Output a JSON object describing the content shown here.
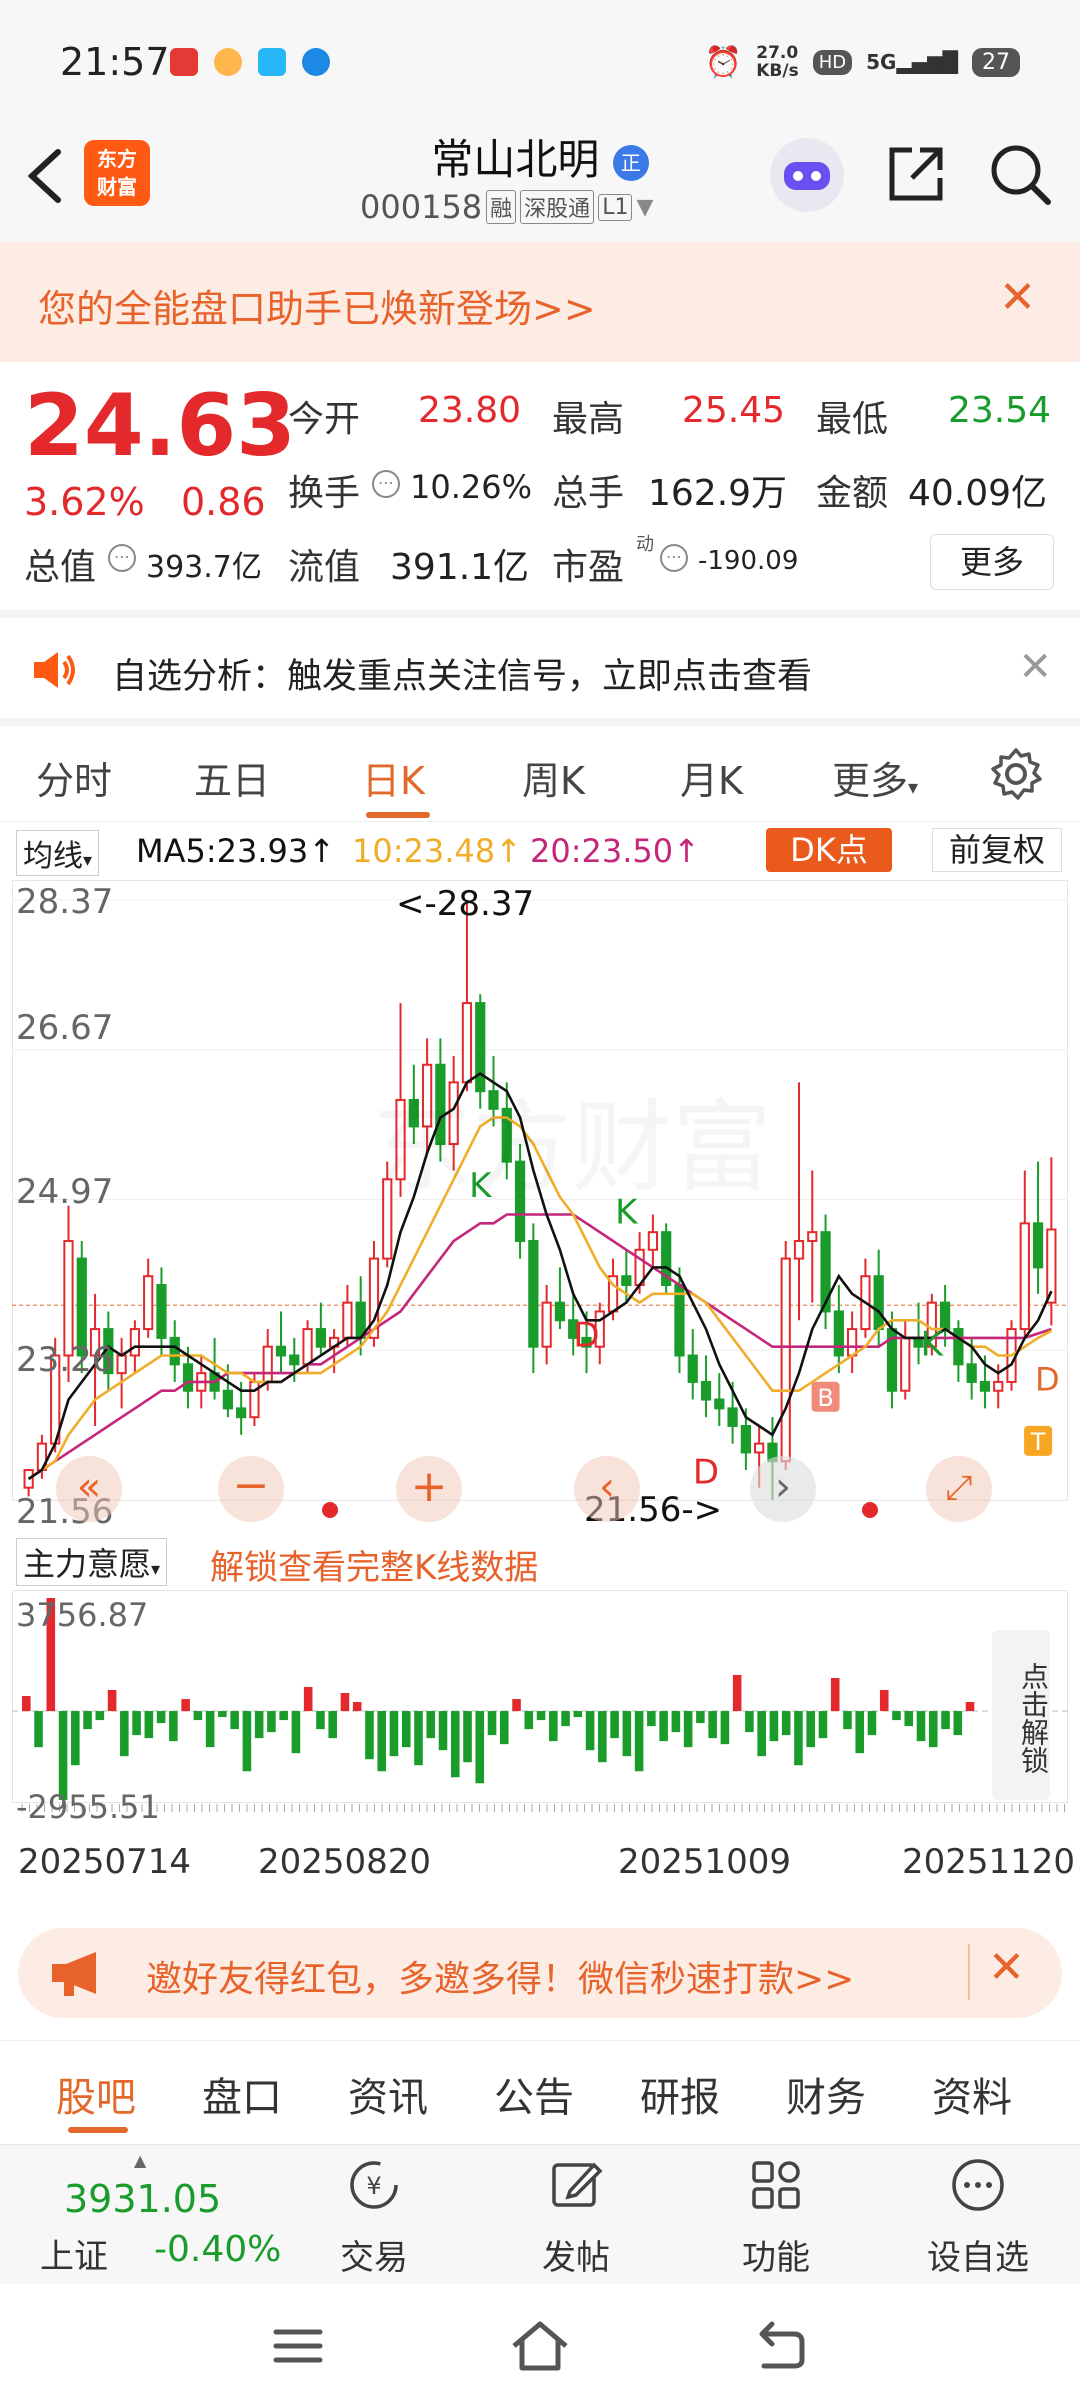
{
  "status_bar": {
    "time": "21:57",
    "net_speed_top": "27.0",
    "net_speed_bottom": "KB/s",
    "hd": "HD",
    "signal": "5G",
    "battery": "27"
  },
  "header": {
    "logo_line1": "东方",
    "logo_line2": "财富",
    "stock_name": "常山北明",
    "stock_badge": "正",
    "stock_code": "000158",
    "tag1": "融",
    "tag2": "深股通",
    "tag3": "L1"
  },
  "banner": {
    "text": "您的全能盘口助手已焕新登场>>"
  },
  "quote": {
    "price": "24.63",
    "change_pct": "3.62%",
    "change_abs": "0.86",
    "open_label": "今开",
    "open": "23.80",
    "high_label": "最高",
    "high": "25.45",
    "low_label": "最低",
    "low": "23.54",
    "turnover_label": "换手",
    "turnover": "10.26%",
    "volume_label": "总手",
    "volume": "162.9万",
    "amount_label": "金额",
    "amount": "40.09亿",
    "mktcap_label": "总值",
    "mktcap": "393.7亿",
    "float_label": "流值",
    "float": "391.1亿",
    "pe_label": "市盈",
    "pe_sup": "动",
    "pe": "-190.09",
    "more": "更多"
  },
  "alert": {
    "text": "自选分析：触发重点关注信号，立即点击查看"
  },
  "tabs": [
    "分时",
    "五日",
    "日K",
    "周K",
    "月K",
    "更多"
  ],
  "ma_bar": {
    "selector": "均线",
    "ma5": "MA5:23.93",
    "ma10": "10:23.48",
    "ma20": "20:23.50",
    "dk": "DK点",
    "adjust": "前复权"
  },
  "chart_labels": {
    "y_top": "28.37",
    "y_2": "26.67",
    "y_3": "24.97",
    "y_4": "23.26",
    "y_bottom": "21.56",
    "max_annot": "<-28.37",
    "min_annot": "21.56->",
    "watermark": "东方财富"
  },
  "subchart": {
    "selector": "主力意愿",
    "unlock": "解锁查看完整K线数据",
    "y_top": "3756.87",
    "y_bottom": "-2955.51",
    "side_unlock": "点击解锁"
  },
  "dates": [
    "20250714",
    "20250820",
    "20251009",
    "20251120"
  ],
  "invite": {
    "text": "邀好友得红包，多邀多得！微信秒速打款>>"
  },
  "news_tabs": [
    "股吧",
    "盘口",
    "资讯",
    "公告",
    "研报",
    "财务",
    "资料"
  ],
  "bottom_bar": {
    "index_value": "3931.05",
    "index_name": "上证",
    "index_change": "-0.40%",
    "trade": "交易",
    "post": "发帖",
    "func": "功能",
    "watch": "设自选"
  },
  "chart_data": {
    "type": "candlestick",
    "ylim": [
      21.56,
      28.37
    ],
    "yticks": [
      28.37,
      26.67,
      24.97,
      23.26,
      21.56
    ],
    "xticks": [
      "20250714",
      "20250820",
      "20251009",
      "20251120"
    ],
    "candles": [
      [
        21.7,
        21.9,
        21.6,
        21.9
      ],
      [
        21.9,
        22.3,
        21.8,
        22.2
      ],
      [
        22.2,
        23.4,
        22.1,
        23.2
      ],
      [
        23.2,
        24.9,
        22.9,
        24.5
      ],
      [
        24.3,
        24.5,
        23.0,
        23.2
      ],
      [
        23.2,
        23.9,
        22.4,
        23.5
      ],
      [
        23.5,
        23.7,
        22.8,
        23.0
      ],
      [
        23.0,
        23.4,
        22.6,
        23.2
      ],
      [
        23.2,
        23.6,
        23.0,
        23.5
      ],
      [
        23.5,
        24.3,
        23.4,
        24.1
      ],
      [
        24.0,
        24.2,
        23.2,
        23.4
      ],
      [
        23.4,
        23.6,
        22.9,
        23.1
      ],
      [
        23.1,
        23.3,
        22.6,
        22.8
      ],
      [
        22.8,
        23.2,
        22.6,
        23.0
      ],
      [
        23.0,
        23.4,
        22.7,
        22.8
      ],
      [
        22.8,
        23.1,
        22.5,
        22.6
      ],
      [
        22.6,
        22.9,
        22.3,
        22.5
      ],
      [
        22.5,
        23.0,
        22.4,
        22.9
      ],
      [
        22.9,
        23.5,
        22.8,
        23.3
      ],
      [
        23.3,
        23.7,
        23.0,
        23.2
      ],
      [
        23.2,
        23.4,
        22.9,
        23.1
      ],
      [
        23.1,
        23.6,
        23.0,
        23.5
      ],
      [
        23.5,
        23.8,
        23.2,
        23.3
      ],
      [
        23.3,
        23.5,
        23.0,
        23.4
      ],
      [
        23.4,
        24.0,
        23.3,
        23.8
      ],
      [
        23.8,
        24.1,
        23.2,
        23.4
      ],
      [
        23.4,
        24.5,
        23.3,
        24.3
      ],
      [
        24.3,
        25.4,
        24.2,
        25.2
      ],
      [
        25.2,
        27.2,
        25.0,
        26.1
      ],
      [
        26.1,
        26.5,
        25.6,
        25.8
      ],
      [
        25.8,
        26.8,
        25.5,
        26.5
      ],
      [
        26.5,
        26.8,
        25.4,
        25.6
      ],
      [
        25.6,
        26.6,
        25.3,
        26.3
      ],
      [
        26.3,
        28.37,
        26.2,
        27.2
      ],
      [
        27.2,
        27.3,
        26.0,
        26.2
      ],
      [
        26.2,
        26.6,
        25.8,
        26.0
      ],
      [
        26.0,
        26.3,
        25.2,
        25.4
      ],
      [
        25.4,
        25.6,
        24.3,
        24.5
      ],
      [
        24.5,
        24.7,
        23.0,
        23.3
      ],
      [
        23.3,
        24.0,
        23.1,
        23.8
      ],
      [
        23.8,
        24.2,
        23.5,
        23.6
      ],
      [
        23.6,
        23.9,
        23.2,
        23.4
      ],
      [
        23.4,
        23.7,
        23.0,
        23.3
      ],
      [
        23.3,
        23.8,
        23.1,
        23.7
      ],
      [
        23.7,
        24.3,
        23.6,
        24.1
      ],
      [
        24.1,
        24.4,
        23.8,
        24.0
      ],
      [
        24.0,
        24.6,
        23.9,
        24.4
      ],
      [
        24.4,
        24.8,
        24.2,
        24.6
      ],
      [
        24.6,
        24.7,
        23.9,
        24.0
      ],
      [
        24.0,
        24.2,
        23.0,
        23.2
      ],
      [
        23.2,
        23.5,
        22.7,
        22.9
      ],
      [
        22.9,
        23.2,
        22.5,
        22.7
      ],
      [
        22.7,
        23.0,
        22.4,
        22.6
      ],
      [
        22.6,
        22.9,
        22.2,
        22.4
      ],
      [
        22.4,
        22.6,
        21.9,
        22.1
      ],
      [
        22.1,
        22.4,
        21.7,
        22.2
      ],
      [
        22.2,
        22.5,
        21.56,
        22.0
      ],
      [
        22.0,
        24.5,
        21.9,
        24.3
      ],
      [
        24.3,
        26.3,
        23.6,
        24.5
      ],
      [
        24.5,
        25.3,
        23.8,
        24.6
      ],
      [
        24.6,
        24.8,
        23.5,
        23.7
      ],
      [
        23.7,
        24.0,
        23.0,
        23.2
      ],
      [
        23.2,
        23.7,
        23.0,
        23.5
      ],
      [
        23.5,
        24.3,
        23.4,
        24.1
      ],
      [
        24.1,
        24.4,
        23.3,
        23.5
      ],
      [
        23.5,
        23.7,
        22.6,
        22.8
      ],
      [
        22.8,
        23.6,
        22.7,
        23.4
      ],
      [
        23.4,
        23.8,
        23.1,
        23.3
      ],
      [
        23.3,
        23.9,
        23.2,
        23.8
      ],
      [
        23.8,
        24.0,
        23.3,
        23.5
      ],
      [
        23.5,
        23.6,
        22.9,
        23.1
      ],
      [
        23.1,
        23.4,
        22.7,
        22.9
      ],
      [
        22.9,
        23.2,
        22.6,
        22.8
      ],
      [
        22.8,
        23.1,
        22.6,
        22.9
      ],
      [
        22.9,
        23.6,
        22.8,
        23.5
      ],
      [
        23.5,
        25.3,
        23.4,
        24.7
      ],
      [
        24.7,
        25.4,
        23.9,
        24.2
      ],
      [
        23.8,
        25.45,
        23.54,
        24.63
      ]
    ],
    "ma5": [
      21.8,
      21.9,
      22.2,
      22.7,
      22.9,
      23.1,
      23.3,
      23.2,
      23.3,
      23.3,
      23.3,
      23.3,
      23.2,
      23.1,
      23.0,
      22.9,
      22.8,
      22.8,
      22.9,
      22.9,
      23.0,
      23.1,
      23.2,
      23.3,
      23.4,
      23.4,
      23.6,
      24.0,
      24.6,
      25.0,
      25.5,
      25.9,
      26.0,
      26.3,
      26.4,
      26.3,
      26.2,
      25.9,
      25.3,
      24.8,
      24.4,
      23.9,
      23.6,
      23.6,
      23.7,
      23.8,
      24.0,
      24.2,
      24.2,
      24.1,
      23.8,
      23.5,
      23.1,
      22.8,
      22.5,
      22.4,
      22.3,
      22.6,
      23.0,
      23.5,
      23.8,
      24.1,
      23.9,
      23.8,
      23.7,
      23.5,
      23.4,
      23.4,
      23.4,
      23.5,
      23.4,
      23.3,
      23.1,
      23.0,
      23.1,
      23.4,
      23.6,
      23.93
    ],
    "ma10": [
      21.8,
      21.9,
      22.0,
      22.3,
      22.5,
      22.7,
      22.8,
      22.9,
      23.0,
      23.1,
      23.2,
      23.2,
      23.2,
      23.2,
      23.1,
      23.0,
      23.0,
      22.9,
      22.9,
      22.9,
      23.0,
      23.0,
      23.0,
      23.1,
      23.2,
      23.3,
      23.5,
      23.7,
      24.0,
      24.3,
      24.6,
      24.9,
      25.2,
      25.5,
      25.8,
      25.9,
      25.9,
      25.8,
      25.6,
      25.3,
      25.0,
      24.8,
      24.5,
      24.2,
      24.0,
      23.9,
      23.8,
      23.9,
      23.9,
      23.9,
      23.9,
      23.8,
      23.6,
      23.4,
      23.2,
      23.0,
      22.8,
      22.8,
      22.8,
      22.9,
      23.0,
      23.1,
      23.2,
      23.3,
      23.5,
      23.6,
      23.6,
      23.6,
      23.5,
      23.5,
      23.4,
      23.3,
      23.3,
      23.2,
      23.2,
      23.3,
      23.4,
      23.48
    ],
    "ma20": [
      21.8,
      21.9,
      22.0,
      22.1,
      22.2,
      22.3,
      22.4,
      22.5,
      22.6,
      22.7,
      22.8,
      22.8,
      22.9,
      22.9,
      22.9,
      23.0,
      23.0,
      23.0,
      23.0,
      23.0,
      23.0,
      23.1,
      23.1,
      23.2,
      23.3,
      23.4,
      23.5,
      23.6,
      23.7,
      23.9,
      24.1,
      24.3,
      24.5,
      24.6,
      24.7,
      24.7,
      24.8,
      24.8,
      24.8,
      24.8,
      24.8,
      24.8,
      24.7,
      24.6,
      24.5,
      24.4,
      24.3,
      24.2,
      24.1,
      24.0,
      23.9,
      23.8,
      23.7,
      23.6,
      23.5,
      23.4,
      23.3,
      23.3,
      23.3,
      23.3,
      23.3,
      23.3,
      23.3,
      23.3,
      23.3,
      23.4,
      23.4,
      23.4,
      23.4,
      23.4,
      23.4,
      23.4,
      23.4,
      23.4,
      23.4,
      23.4,
      23.45,
      23.5
    ],
    "series": [
      {
        "name": "MA5",
        "color": "#111111"
      },
      {
        "name": "10",
        "color": "#f0ad2a"
      },
      {
        "name": "20",
        "color": "#c4267a"
      }
    ],
    "flow": [
      500,
      -1200,
      3756.87,
      -2955.51,
      -1800,
      -600,
      -300,
      700,
      -1500,
      -800,
      -900,
      -400,
      -1000,
      400,
      -300,
      -1200,
      -200,
      -600,
      -2000,
      -900,
      -700,
      -300,
      -1400,
      800,
      -600,
      -900,
      600,
      300,
      -1600,
      -2000,
      -1500,
      -1200,
      -1800,
      -900,
      -1300,
      -2200,
      -1700,
      -2400,
      -800,
      -1100,
      400,
      -600,
      -300,
      -1000,
      -500,
      -200,
      -1300,
      -1700,
      -900,
      -1500,
      -2000,
      -500,
      -1000,
      -700,
      -1200,
      -400,
      -900,
      -1100,
      1200,
      -700,
      -1500,
      -1000,
      -800,
      -1800,
      -1200,
      -900,
      1100,
      -600,
      -1400,
      -800,
      700,
      -300,
      -500,
      -1000,
      -1200,
      -600,
      -800,
      300
    ]
  },
  "colors": {
    "up": "#e3292c",
    "down": "#1a9c2b",
    "accent": "#e3692b",
    "banner_bg": "#fdece3"
  }
}
